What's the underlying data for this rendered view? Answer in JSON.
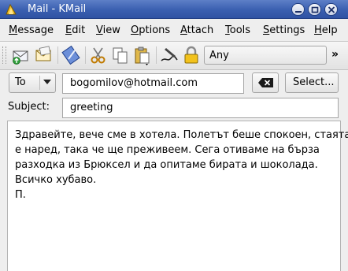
{
  "window": {
    "title": "Mail - KMail"
  },
  "menu": {
    "items": [
      {
        "key": "M",
        "rest": "essage"
      },
      {
        "key": "E",
        "rest": "dit"
      },
      {
        "key": "V",
        "rest": "iew"
      },
      {
        "key": "O",
        "rest": "ptions"
      },
      {
        "key": "A",
        "rest": "ttach"
      },
      {
        "key": "T",
        "rest": "ools"
      },
      {
        "key": "S",
        "rest": "ettings"
      },
      {
        "key": "H",
        "rest": "elp"
      }
    ]
  },
  "toolbar": {
    "icons": [
      "send-icon",
      "queue-icon",
      "attach-icon",
      "cut-icon",
      "copy-icon",
      "paste-icon",
      "sign-icon",
      "encrypt-icon"
    ],
    "combo_value": "Any",
    "overflow": "»"
  },
  "header": {
    "recipient_type": "To",
    "to_value": "bogomilov@hotmail.com",
    "select_label": "Select...",
    "subject_label": "Subject:",
    "subject_value": "greeting"
  },
  "message": {
    "lines": [
      "Здравейте, вече сме в хотела. Полетът беше спокоен, стаята",
      "е наред, така че ще преживеем. Сега отиваме на бърза",
      "разходка из Брюксел и да опитаме бирата и шоколада.",
      "Всичко хубаво.",
      "П."
    ]
  }
}
